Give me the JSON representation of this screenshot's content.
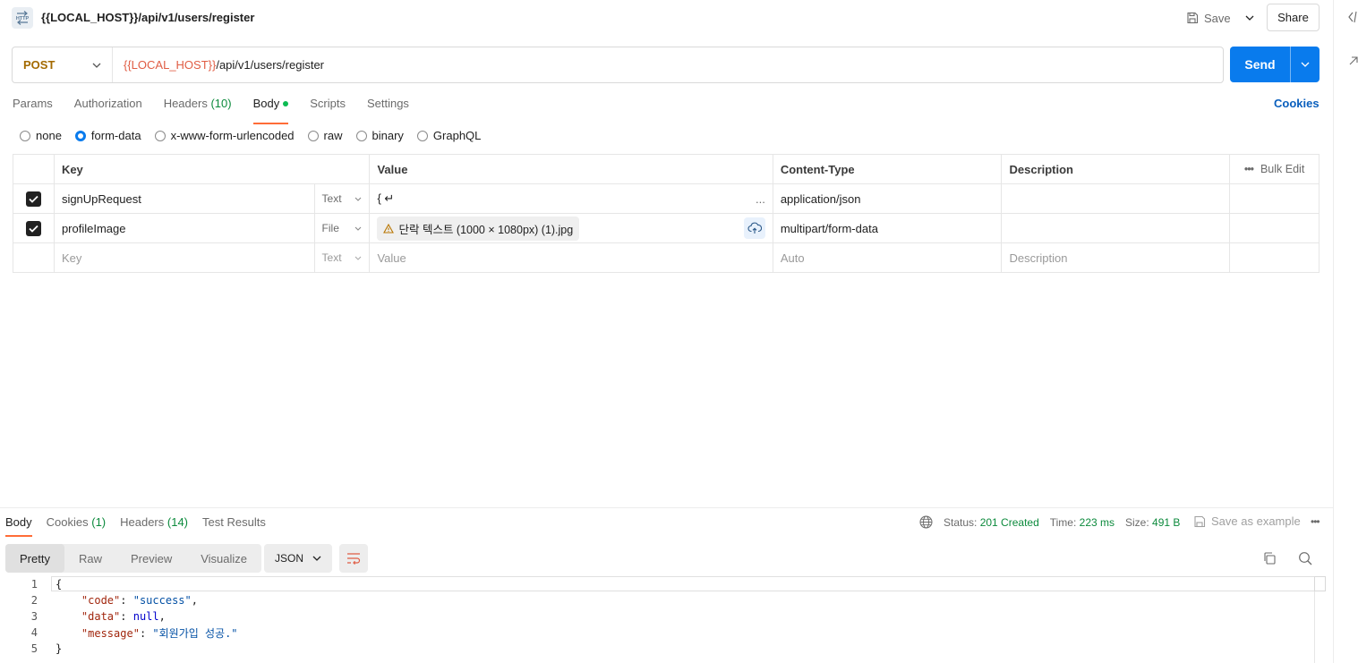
{
  "header": {
    "title": "{{LOCAL_HOST}}/api/v1/users/register",
    "http_icon_label": "HTTP",
    "save_label": "Save",
    "share_label": "Share"
  },
  "request": {
    "method": "POST",
    "url_var": "{{LOCAL_HOST}}",
    "url_path": "/api/v1/users/register",
    "send_label": "Send"
  },
  "tabs": {
    "params": "Params",
    "authorization": "Authorization",
    "headers_label": "Headers",
    "headers_count": "(10)",
    "body": "Body",
    "scripts": "Scripts",
    "settings": "Settings",
    "cookies": "Cookies"
  },
  "body_types": [
    "none",
    "form-data",
    "x-www-form-urlencoded",
    "raw",
    "binary",
    "GraphQL"
  ],
  "selected_body_type": "form-data",
  "table": {
    "headers": {
      "key": "Key",
      "value": "Value",
      "content_type": "Content-Type",
      "description": "Description",
      "bulk_edit": "Bulk Edit"
    },
    "rows": [
      {
        "checked": true,
        "key": "signUpRequest",
        "type": "Text",
        "value": "{ ↵",
        "value_more": "...",
        "content_type": "application/json",
        "description": ""
      },
      {
        "checked": true,
        "key": "profileImage",
        "type": "File",
        "value": "단락 텍스트 (1000 × 1080px) (1).jpg",
        "content_type": "multipart/form-data",
        "description": ""
      }
    ],
    "placeholder_row": {
      "key": "Key",
      "type": "Text",
      "value": "Value",
      "content_type": "Auto",
      "description": "Description"
    }
  },
  "response": {
    "tabs": {
      "body": "Body",
      "cookies": "Cookies",
      "cookies_count": "(1)",
      "headers": "Headers",
      "headers_count": "(14)",
      "test_results": "Test Results"
    },
    "status_label": "Status:",
    "status_value": "201 Created",
    "time_label": "Time:",
    "time_value": "223 ms",
    "size_label": "Size:",
    "size_value": "491 B",
    "save_example": "Save as example",
    "views": [
      "Pretty",
      "Raw",
      "Preview",
      "Visualize"
    ],
    "active_view": "Pretty",
    "format": "JSON",
    "code_lines": [
      {
        "n": "1",
        "text": "{"
      },
      {
        "n": "2",
        "key": "\"code\"",
        "sep": ": ",
        "val": "\"success\"",
        "tail": ",",
        "kind": "s"
      },
      {
        "n": "3",
        "key": "\"data\"",
        "sep": ": ",
        "val": "null",
        "tail": ",",
        "kind": "n"
      },
      {
        "n": "4",
        "key": "\"message\"",
        "sep": ": ",
        "val": "\"회원가입 성공.\"",
        "tail": "",
        "kind": "s"
      },
      {
        "n": "5",
        "text": "}"
      }
    ]
  },
  "colors": {
    "accent_orange": "#ff6c37",
    "send_blue": "#097bed",
    "method_post": "#a36a00",
    "var_red": "#e05d44",
    "success_green": "#0c8a3c"
  }
}
